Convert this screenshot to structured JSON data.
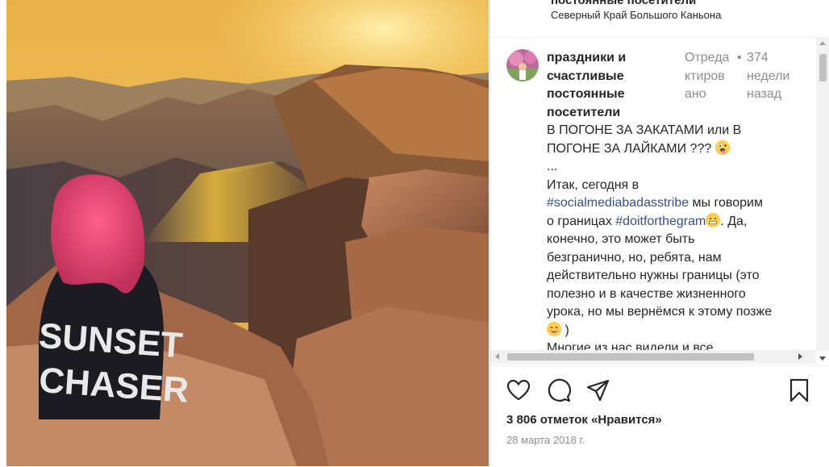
{
  "post": {
    "author_header": "постоянные посетители",
    "location": "Северный Край Большого Каньона"
  },
  "photo": {
    "shirt_line1": "SUNSET",
    "shirt_line2": "CHASER"
  },
  "comment": {
    "author_lines": [
      "праздники и",
      "счастливые",
      "постоянные",
      "посетители"
    ],
    "meta_col1": [
      "Отреда",
      "ктиров",
      "ано"
    ],
    "meta_col2": "•",
    "meta_col3": [
      "374",
      "недели",
      "назад"
    ],
    "caption_lines": [
      "В ПОГОНЕ ЗА ЗАКАТАМИ или В",
      "ПОГОНЕ ЗА ЛАЙКАМИ ??? ",
      "...",
      "Итак, сегодня в"
    ],
    "hashtag1": "#socialmediabadasstribe",
    "after_hashtag1": " мы говорим",
    "before_hashtag2": "о границах ",
    "hashtag2": "#doitforthegram",
    "after_hashtag2": ". Да,",
    "lines_after": [
      "конечно, это может быть",
      "безгранично, но, ребята, нам",
      "действительно нужны границы (это",
      "полезно и в качестве жизненного",
      "урока, но мы вернёмся к этому позже"
    ],
    "closing": " )",
    "cutoff_line": "Многие из нас видели и все"
  },
  "actions": {
    "like_icon": "heart-icon",
    "comment_icon": "comment-icon",
    "share_icon": "share-icon",
    "save_icon": "bookmark-icon"
  },
  "likes_text": "3 806 отметок «Нравится»",
  "date_text": "28 марта 2018 г."
}
